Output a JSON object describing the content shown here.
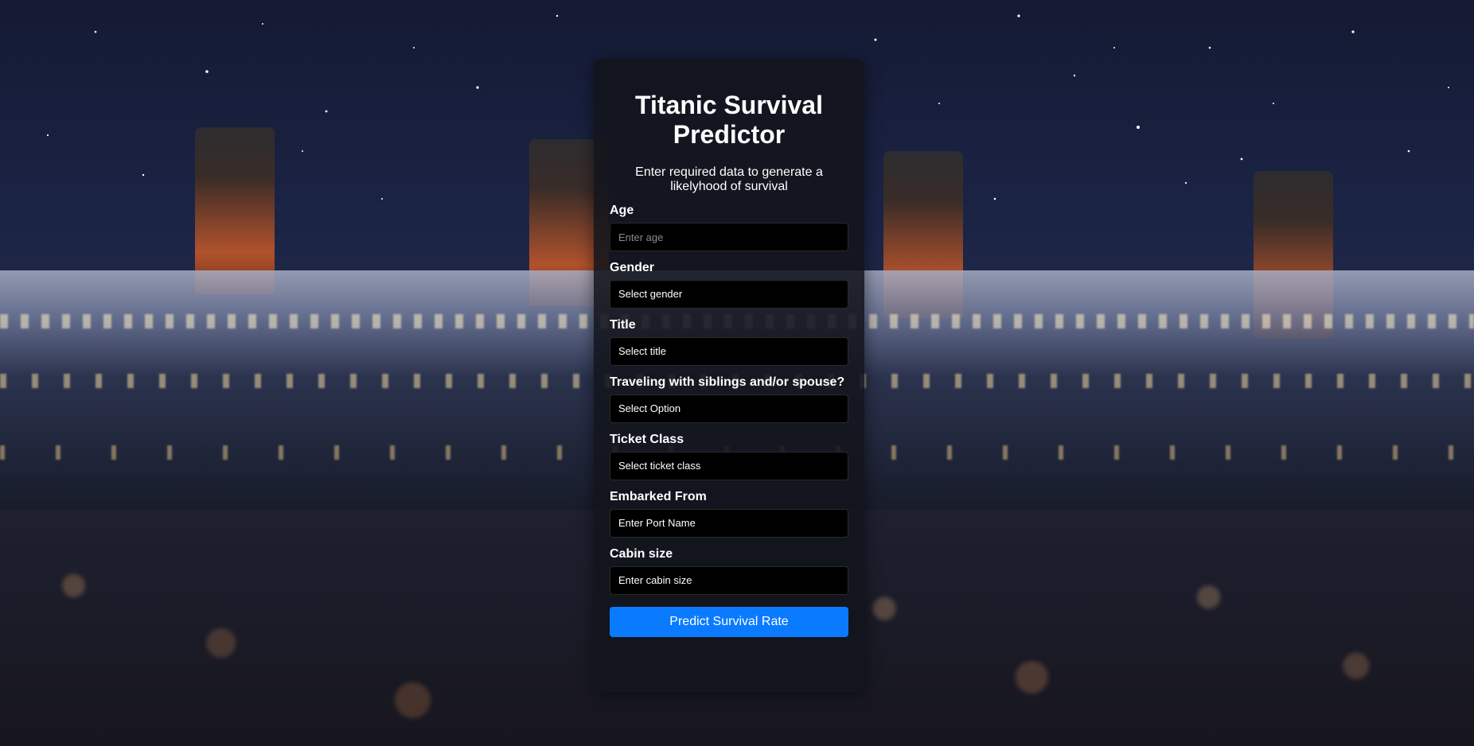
{
  "form": {
    "title": "Titanic Survival Predictor",
    "subtitle": "Enter required data to generate a likelyhood of survival",
    "fields": [
      {
        "label": "Age",
        "placeholder": "Enter age",
        "type": "input"
      },
      {
        "label": "Gender",
        "value": "Select gender",
        "type": "select"
      },
      {
        "label": "Title",
        "value": "Select title",
        "type": "select"
      },
      {
        "label": "Traveling with siblings and/or spouse?",
        "value": "Select Option",
        "type": "select"
      },
      {
        "label": "Ticket Class",
        "value": "Select ticket class",
        "type": "select"
      },
      {
        "label": "Embarked From",
        "value": "Enter Port Name",
        "type": "select"
      },
      {
        "label": "Cabin size",
        "value": "Enter cabin size",
        "type": "select"
      }
    ],
    "submit_label": "Predict Survival Rate"
  },
  "colors": {
    "accent": "#0a7bff",
    "card_bg": "#12141c",
    "field_bg": "#000000"
  }
}
